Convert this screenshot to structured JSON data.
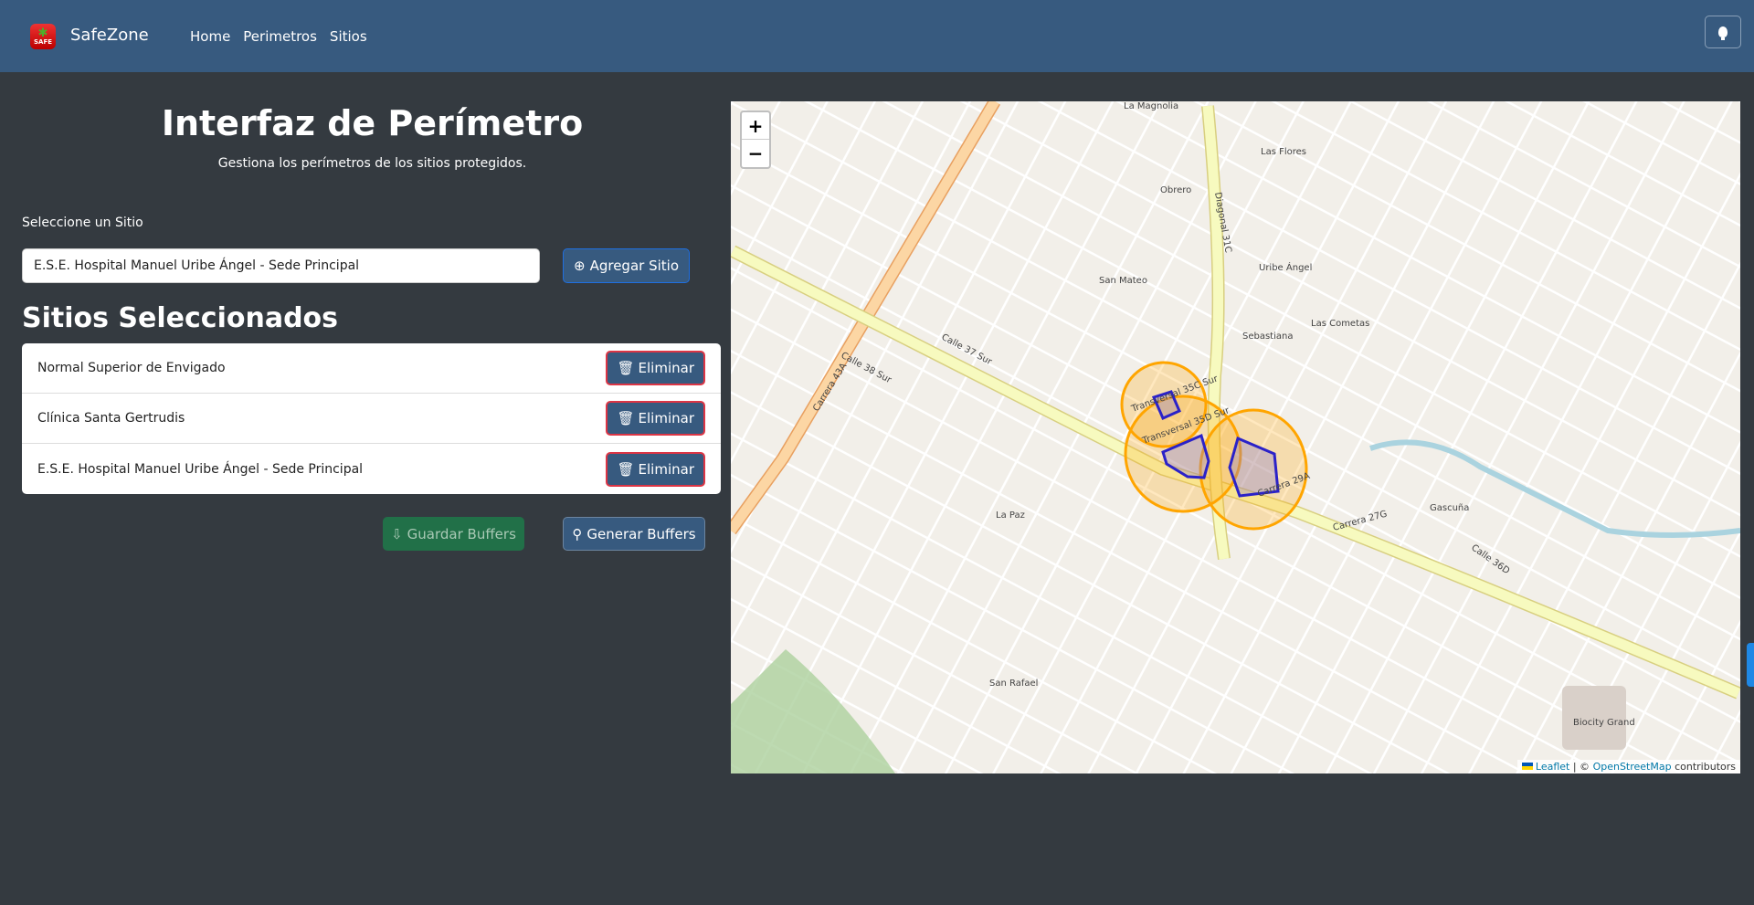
{
  "navbar": {
    "brand": "SafeZone",
    "logo_text": "SAFE",
    "links": [
      "Home",
      "Perimetros",
      "Sitios"
    ],
    "theme_icon": "lightbulb-icon"
  },
  "header": {
    "title": "Interfaz de Perímetro",
    "subtitle": "Gestiona los perímetros de los sitios protegidos."
  },
  "selector": {
    "label": "Seleccione un Sitio",
    "value": "E.S.E. Hospital Manuel Uribe Ángel - Sede Principal",
    "add_label": "Agregar Sitio"
  },
  "selected": {
    "title": "Sitios Seleccionados",
    "items": [
      {
        "name": "Normal Superior de Envigado",
        "action": "Eliminar"
      },
      {
        "name": "Clínica Santa Gertrudis",
        "action": "Eliminar"
      },
      {
        "name": "E.S.E. Hospital Manuel Uribe Ángel - Sede Principal",
        "action": "Eliminar"
      }
    ]
  },
  "actions": {
    "save": "Guardar Buffers",
    "generate": "Generar Buffers"
  },
  "map": {
    "zoom_in": "+",
    "zoom_out": "−",
    "attribution": {
      "leaflet": "Leaflet",
      "sep": "| ©",
      "osm": "OpenStreetMap",
      "suffix": "contributors"
    },
    "buffer_color": "#ffa500",
    "polygon_color": "#2b22c8",
    "labels": [
      "Calle 37 Sur",
      "Calle 38 Sur",
      "Carrera 43A",
      "Diagonal 31C",
      "Carrera 27G",
      "Calle 36D",
      "La Paz",
      "San Rafael",
      "San Mateo",
      "Uribe Ángel",
      "Las Flores",
      "Sebastiana",
      "Las Cometas",
      "Gascuña",
      "Biocity Grand",
      "Transversal 35C Sur",
      "Transversal 35D Sur",
      "Carrera 29A",
      "La Magnolia",
      "Obrero"
    ]
  }
}
